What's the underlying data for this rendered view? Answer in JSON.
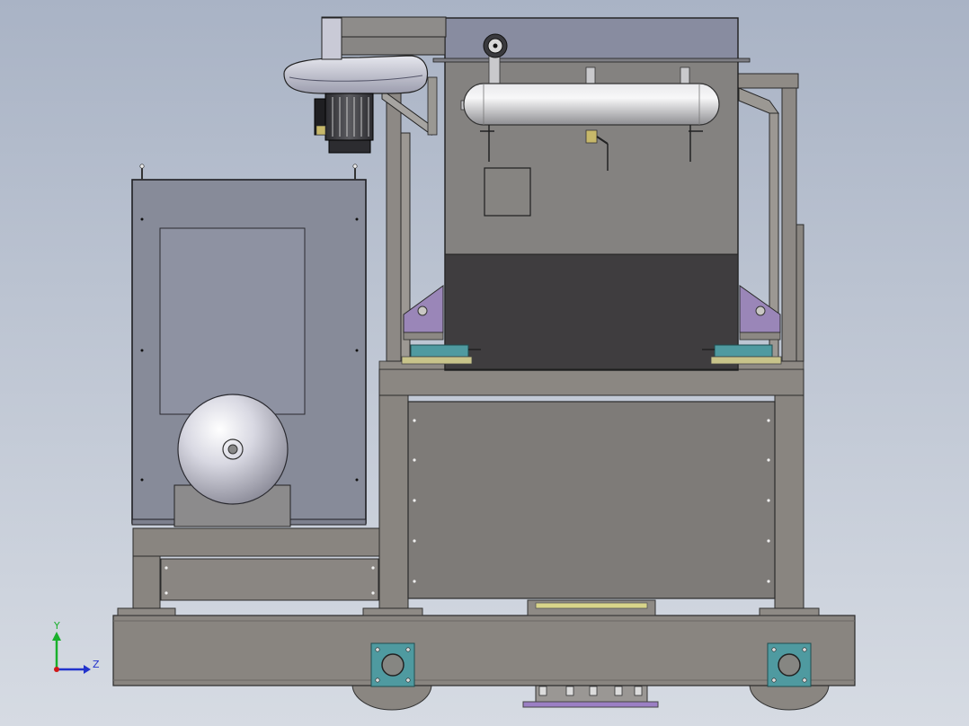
{
  "app": {
    "view_type": "cad-model-viewport",
    "model_description_shown": false
  },
  "colors": {
    "background_top": "#aab4c6",
    "background_bottom": "#d4d9e2",
    "frame_steel": "#898580",
    "panel_steel": "#7e7b78",
    "cabinet_blue": "#878b99",
    "dark_panel": "#3f3d3f",
    "purple_bracket": "#9a86b8",
    "teal_plate": "#4f9aa0",
    "yellow_plate": "#c8c48a",
    "tank_silver": "#c8c8cc",
    "sphere_lavender": "#d2d2dc",
    "axis_y": "#19b02c",
    "axis_z": "#2233cc",
    "axis_x": "#d01818"
  },
  "triad": {
    "y_label": "Y",
    "z_label": "Z"
  }
}
